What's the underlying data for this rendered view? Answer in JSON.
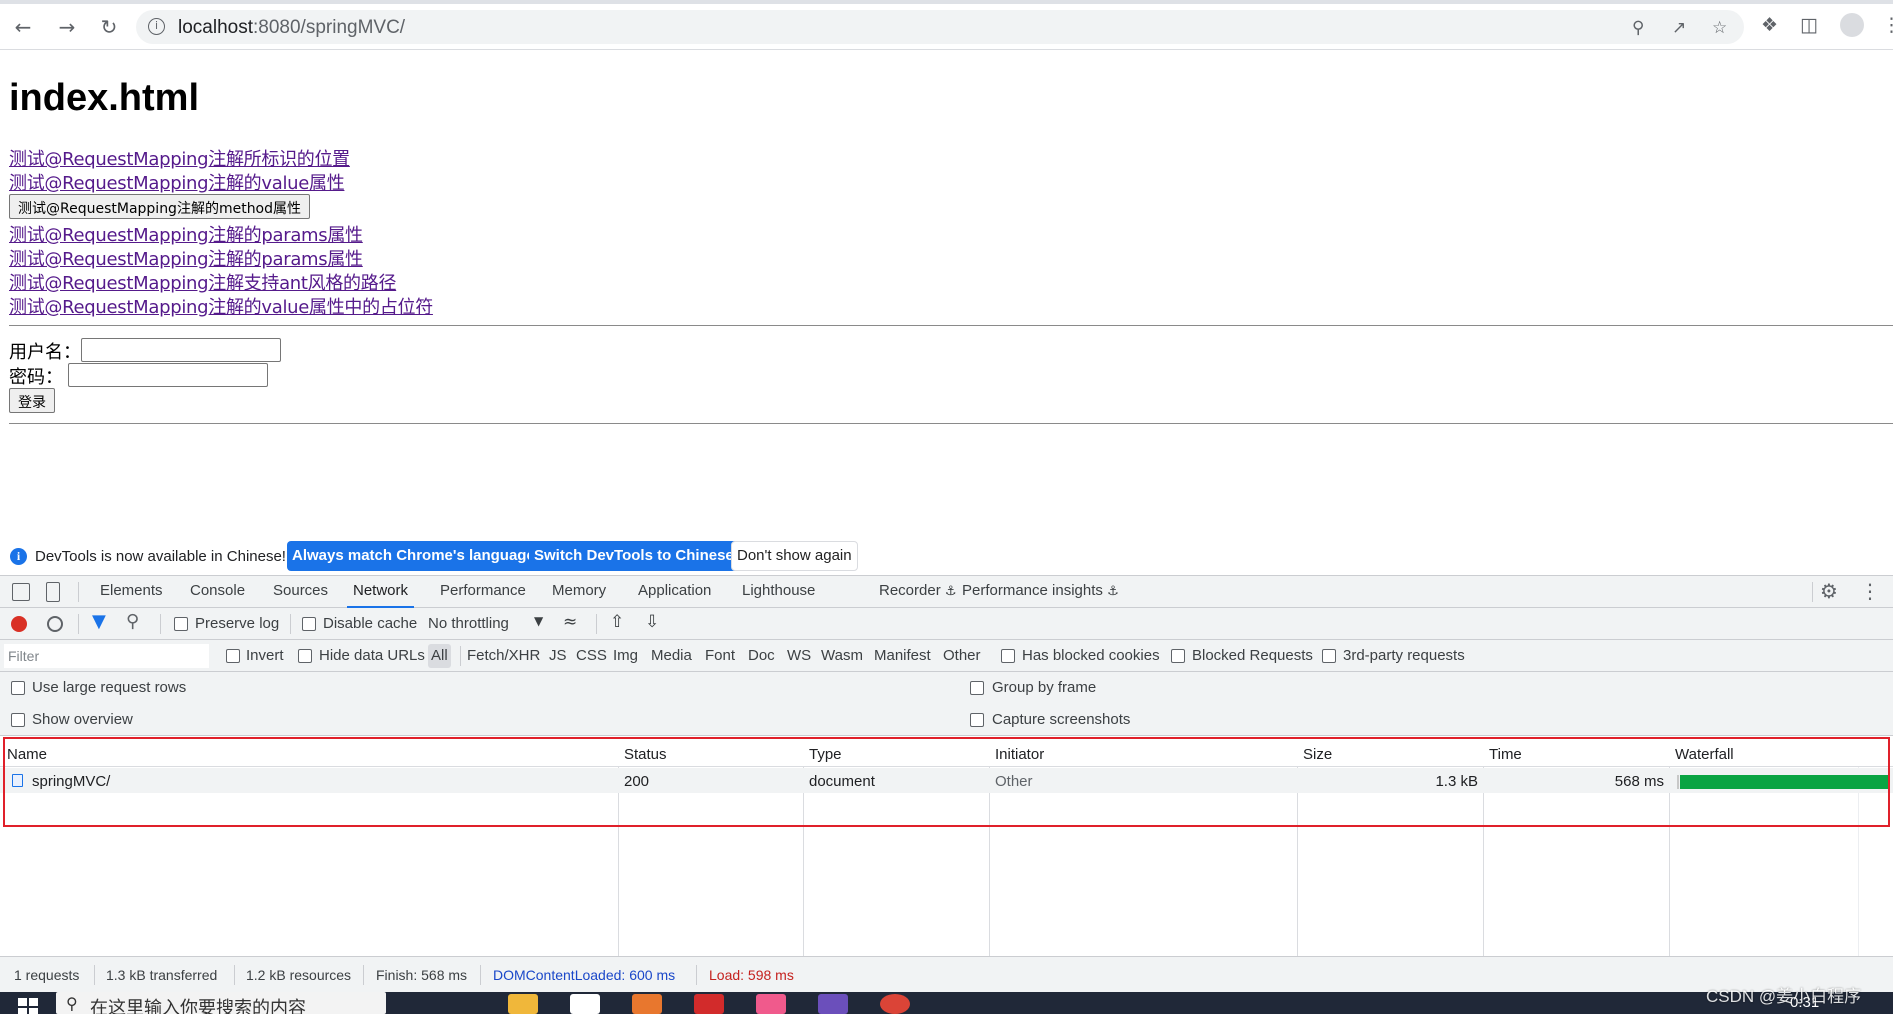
{
  "browser": {
    "url_host": "localhost",
    "url_rest": ":8080/springMVC/"
  },
  "page": {
    "title": "index.html",
    "links": [
      "测试@RequestMapping注解所标识的位置",
      "测试@RequestMapping注解的value属性"
    ],
    "method_button": "测试@RequestMapping注解的method属性",
    "links2": [
      "测试@RequestMapping注解的params属性",
      "测试@RequestMapping注解的params属性",
      "测试@RequestMapping注解支持ant风格的路径",
      "测试@RequestMapping注解的value属性中的占位符"
    ],
    "username_label": "用户名：",
    "password_label": "密码：",
    "login_button": "登录"
  },
  "devtools": {
    "lang_message": "DevTools is now available in Chinese!",
    "lang_buttons": [
      "Always match Chrome's language",
      "Switch DevTools to Chinese",
      "Don't show again"
    ],
    "tabs": [
      "Elements",
      "Console",
      "Sources",
      "Network",
      "Performance",
      "Memory",
      "Application",
      "Lighthouse",
      "Recorder",
      "Performance insights"
    ],
    "active_tab": "Network",
    "preserve_log": "Preserve log",
    "disable_cache": "Disable cache",
    "throttling": "No throttling",
    "filter_placeholder": "Filter",
    "invert": "Invert",
    "hide_data_urls": "Hide data URLs",
    "types": [
      "All",
      "Fetch/XHR",
      "JS",
      "CSS",
      "Img",
      "Media",
      "Font",
      "Doc",
      "WS",
      "Wasm",
      "Manifest",
      "Other"
    ],
    "has_blocked_cookies": "Has blocked cookies",
    "blocked_requests": "Blocked Requests",
    "third_party": "3rd-party requests",
    "use_large_rows": "Use large request rows",
    "show_overview": "Show overview",
    "group_by_frame": "Group by frame",
    "capture_screenshots": "Capture screenshots",
    "columns": [
      "Name",
      "Status",
      "Type",
      "Initiator",
      "Size",
      "Time",
      "Waterfall"
    ],
    "rows": [
      {
        "name": "springMVC/",
        "status": "200",
        "type": "document",
        "initiator": "Other",
        "size": "1.3 kB",
        "time": "568 ms"
      }
    ],
    "status": {
      "requests": "1 requests",
      "transferred": "1.3 kB transferred",
      "resources": "1.2 kB resources",
      "finish": "Finish: 568 ms",
      "dcl": "DOMContentLoaded: 600 ms",
      "load": "Load: 598 ms"
    },
    "colors": {
      "accent": "#1a73e8",
      "highlight": "#e0202a",
      "waterfall": "#0aa443",
      "dcl": "#1a47c9",
      "load": "#c5221f"
    }
  },
  "taskbar": {
    "search_placeholder": "在这里输入你要搜索的内容",
    "clock": "0:31"
  },
  "watermark": "CSDN @姜小白程序"
}
